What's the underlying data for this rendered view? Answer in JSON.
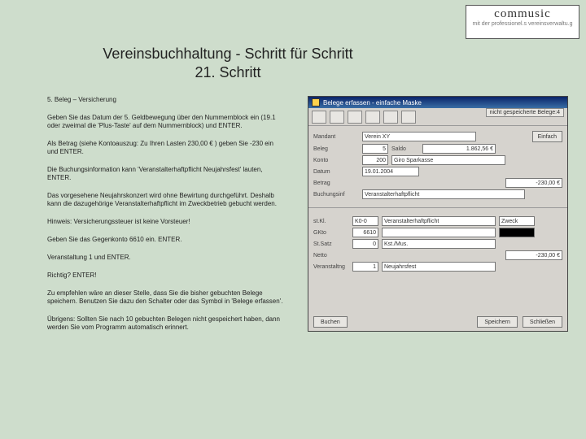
{
  "logo": {
    "title": "commusic",
    "subtitle": "mit der professionel.s vereinsverwaltu.g"
  },
  "page": {
    "title_line1": "Vereinsbuchhaltung - Schritt für Schritt",
    "title_line2": "21. Schritt"
  },
  "paragraphs": [
    "5. Beleg – Versicherung",
    "Geben Sie das Datum der 5. Geldbewegung über den Nummernblock ein (19.1 oder zweimal die 'Plus-Taste' auf dem Nummernblock) und ENTER.",
    "Als Betrag (siehe Kontoauszug: Zu Ihren Lasten   230,00 € ) geben Sie -230 ein und ENTER.",
    "Die Buchungsinformation kann 'Veranstalterhaftpflicht Neujahrsfest' lauten, ENTER.",
    "Das vorgesehene Neujahrskonzert wird ohne Bewirtung durchgeführt. Deshalb kann die dazugehörige Veranstalterhaftpflicht im Zweckbetrieb gebucht werden.",
    "Hinweis: Versicherungssteuer ist keine Vorsteuer!",
    "Geben Sie das Gegenkonto 6610 ein. ENTER.",
    "Veranstaltung 1 und ENTER.",
    "Richtig? ENTER!",
    "Zu empfehlen wäre an dieser Stelle, dass Sie die bisher gebuchten Belege speichern. Benutzen Sie dazu den Schalter oder das Symbol in 'Belege erfassen'.",
    "Übrigens: Sollten Sie nach 10 gebuchten Belegen nicht gespeichert haben, dann werden Sie vom Programm automatisch erinnert."
  ],
  "win": {
    "title": "Belege erfassen - einfache Maske",
    "tab": "nicht gespeicherte Belege:4",
    "labels": {
      "mandant": "Mandant",
      "konto": "Konto",
      "beleg": "Beleg",
      "saldo": "Saldo",
      "datum": "Datum",
      "betrag": "Betrag",
      "info": "Buchungsinf",
      "stkl": "st.Kl.",
      "gkto": "GKto",
      "zweck": "Zweck",
      "stsatz": "St.Satz",
      "kst": "K.st./Mus.",
      "netto": "Netto",
      "veranst": "Veranstaltng"
    },
    "values": {
      "mandant": "Verein XY",
      "beleg": "5",
      "saldo": "1.862,56 €",
      "konto_nr": "200",
      "konto_name": "Giro Sparkasse",
      "datum": "19.01.2004",
      "betrag": "-230,00 €",
      "info": "Veranstalterhaftpflicht",
      "stkl": "K0-0",
      "stkl_name": "Veranstalterhaftpflicht",
      "zweck": "Zweck",
      "gkto": "6610",
      "stsatz": "0",
      "kst": "Kst./Mus.",
      "netto": "-230,00 €",
      "veranst_nr": "1",
      "veranst_name": "Neujahrsfest"
    },
    "buttons": {
      "einfach": "Einfach",
      "buchen": "Buchen",
      "speichern": "Speichern",
      "schliessen": "Schließen"
    }
  }
}
